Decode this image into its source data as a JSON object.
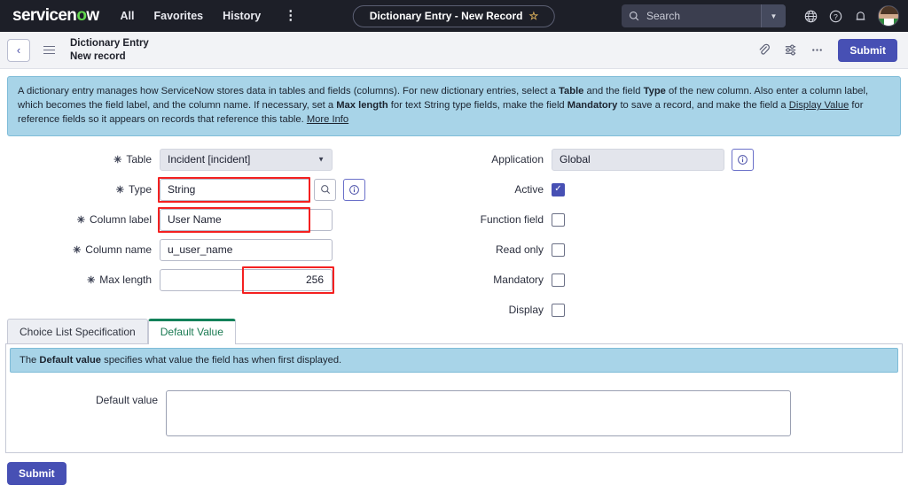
{
  "topnav": {
    "logo": "servicenow",
    "links": [
      {
        "label": "All"
      },
      {
        "label": "Favorites"
      },
      {
        "label": "History"
      }
    ],
    "more_menu": "⋮",
    "record_pill": {
      "label": "Dictionary Entry - New Record",
      "star": "☆"
    },
    "search": {
      "placeholder": "Search",
      "value": "",
      "icon": "search-icon"
    },
    "icons": [
      "globe-icon",
      "help-icon",
      "bell-icon",
      "avatar"
    ]
  },
  "subheader": {
    "back": "‹",
    "title_line1": "Dictionary Entry",
    "title_line2": "New record",
    "icons": [
      "attachment-icon",
      "form-settings-icon",
      "more-actions-icon"
    ],
    "submit_label": "Submit"
  },
  "banner": {
    "p1": "A dictionary entry manages how ServiceNow stores data in tables and fields (columns). For new dictionary entries, select a ",
    "b1": "Table",
    "p2": " and the field ",
    "b2": "Type",
    "p3": " of the new column. Also enter a column label, which becomes the field label, and the column name. If necessary, set a ",
    "b3": "Max length",
    "p4": " for text String type fields, make the field ",
    "b4": "Mandatory",
    "p5": " to save a record, and make the field a ",
    "link1": "Display Value",
    "p6": " for reference fields so it appears on records that reference this table. ",
    "link2": "More Info"
  },
  "form": {
    "left": [
      {
        "label": "Table",
        "required": true,
        "value": "Incident [incident]",
        "control": "select",
        "readonly": true
      },
      {
        "label": "Type",
        "required": true,
        "value": "String",
        "control": "reference",
        "highlight": true
      },
      {
        "label": "Column label",
        "required": true,
        "value": "User Name",
        "control": "text",
        "highlight": true
      },
      {
        "label": "Column name",
        "required": true,
        "value": "u_user_name",
        "control": "text"
      },
      {
        "label": "Max length",
        "required": true,
        "value": "256",
        "control": "number",
        "highlight": true
      }
    ],
    "right": [
      {
        "label": "Application",
        "value": "Global",
        "control": "text",
        "readonly": true,
        "info": true
      },
      {
        "label": "Active",
        "control": "checkbox",
        "checked": true
      },
      {
        "label": "Function field",
        "control": "checkbox",
        "checked": false
      },
      {
        "label": "Read only",
        "control": "checkbox",
        "checked": false
      },
      {
        "label": "Mandatory",
        "control": "checkbox",
        "checked": false
      },
      {
        "label": "Display",
        "control": "checkbox",
        "checked": false
      }
    ],
    "required_marker": "✳"
  },
  "tabs": [
    {
      "label": "Choice List Specification",
      "active": false
    },
    {
      "label": "Default Value",
      "active": true
    }
  ],
  "panel": {
    "banner_p1": "The ",
    "banner_b": "Default value",
    "banner_p2": " specifies what value the field has when first displayed.",
    "field_label": "Default value",
    "field_value": "",
    "field_placeholder": ""
  },
  "footer": {
    "submit_label": "Submit"
  },
  "colors": {
    "nav_bg": "#1d1f28",
    "accent_purple": "#4750b4",
    "banner_blue": "#a8d4e8",
    "tab_green": "#13815a",
    "annotation_red": "#f42020"
  }
}
